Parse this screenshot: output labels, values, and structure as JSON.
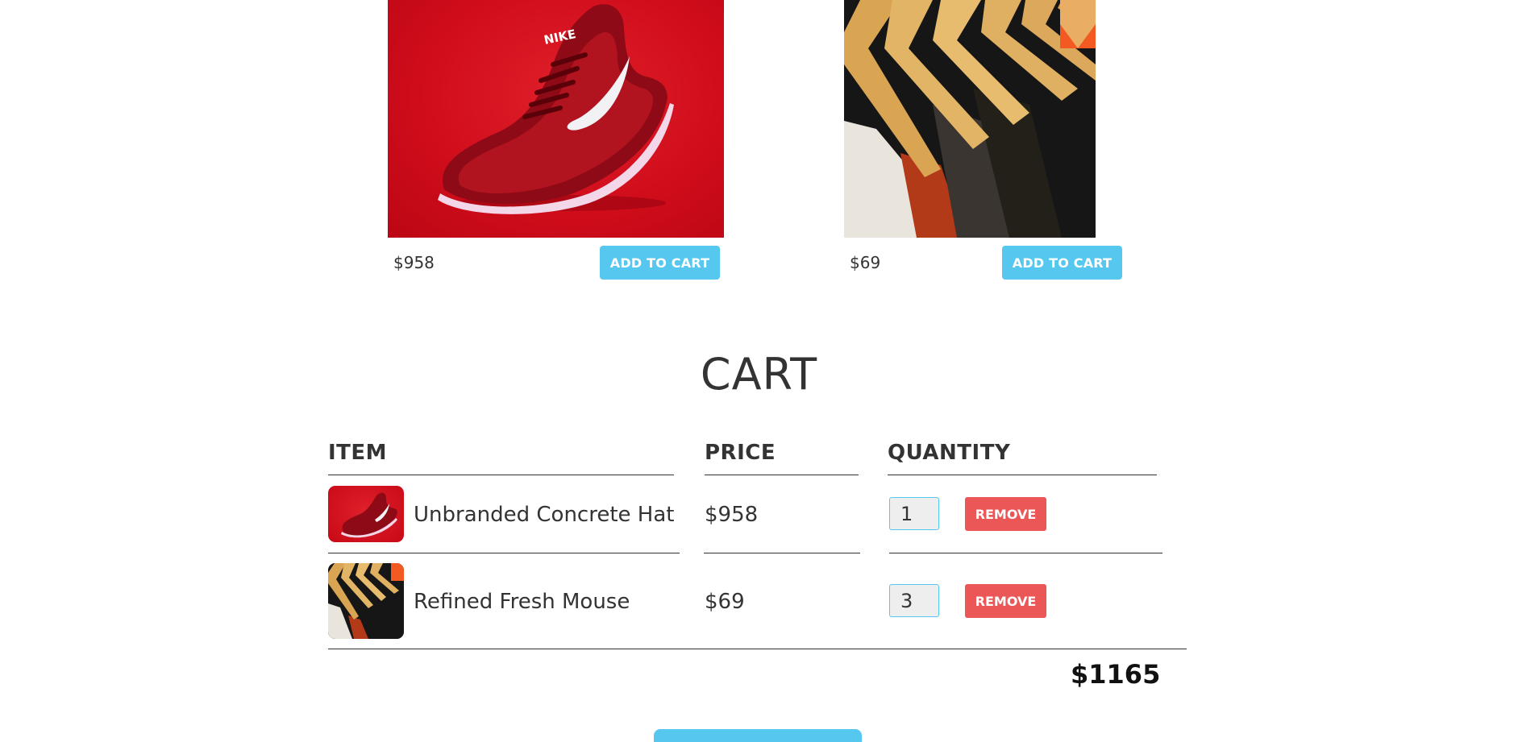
{
  "colors": {
    "accent": "#56c7ef",
    "remove": "#eb5757",
    "text": "#333333"
  },
  "products": [
    {
      "image": "red-sneaker-image",
      "price": "$958",
      "add_label": "ADD TO CART"
    },
    {
      "image": "clothes-rack-image",
      "price": "$69",
      "add_label": "ADD TO CART"
    }
  ],
  "cart": {
    "title": "CART",
    "headers": {
      "item": "ITEM",
      "price": "PRICE",
      "quantity": "QUANTITY"
    },
    "rows": [
      {
        "thumb": "red-sneaker-thumbnail",
        "name": "Unbranded Concrete Hat",
        "price": "$958",
        "quantity": "1",
        "remove_label": "REMOVE"
      },
      {
        "thumb": "clothes-rack-thumbnail",
        "name": "Refined Fresh Mouse",
        "price": "$69",
        "quantity": "3",
        "remove_label": "REMOVE"
      }
    ],
    "total": "$1165"
  }
}
